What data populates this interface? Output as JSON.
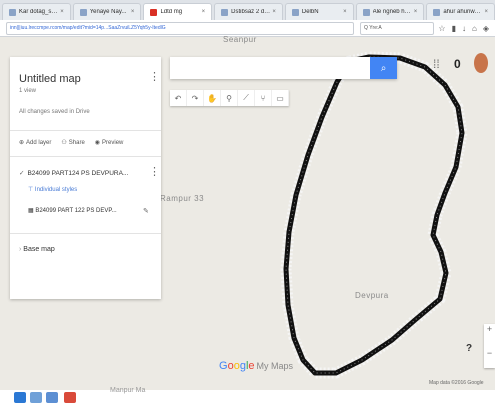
{
  "browser": {
    "tabs": [
      {
        "label": "Kar dotag_sstu dt..."
      },
      {
        "label": "Yenaye Nay..."
      },
      {
        "label": "Ldtd mg"
      },
      {
        "label": "Dstibsaz 2 das"
      },
      {
        "label": "DelbN"
      },
      {
        "label": "Ale ngneb heta at..."
      },
      {
        "label": "ahur ahuriwe rstay..."
      }
    ],
    "url": "inn|||iuu.lreccmpe.rcom/map/edit?mid=14p...SaaZrvuiLZ5Yqh5y-ItedlG",
    "search_placeholder": "Q Yre:A"
  },
  "map": {
    "place_labels": {
      "top": "Seanpur",
      "left": "Rampur 33",
      "inside": "Devpura",
      "bottom": "Manpur Ma"
    },
    "logo": {
      "g": "G",
      "o1": "o",
      "o2": "o",
      "g2": "g",
      "l": "l",
      "e": "e",
      "suffix": "My Maps"
    },
    "attribution": "Map data ©2016 Google"
  },
  "panel": {
    "title": "Untitled map",
    "views": "1 view",
    "saved": "All changes saved in Drive",
    "actions": {
      "add_layer": "Add layer",
      "share": "Share",
      "preview": "Preview"
    },
    "layer_name": "B24099 PART124 PS DEVPURA...",
    "layer_style": "Individual styles",
    "layer_data": "B24099 PART 122 PS DEVP...",
    "basemap": "Base map"
  },
  "top_right": {
    "notification_count": "0"
  },
  "colors": {
    "accent": "#4285f4",
    "polygon_stroke": "#111111"
  }
}
